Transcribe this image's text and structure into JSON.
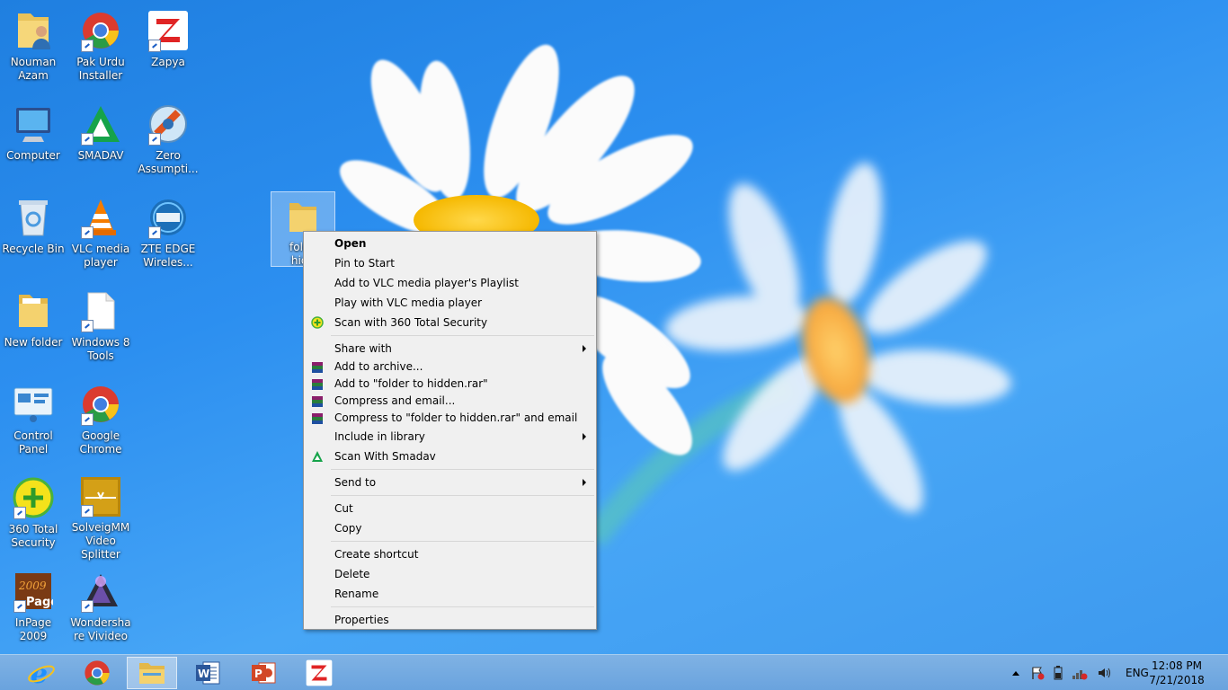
{
  "desktop": {
    "icons": [
      {
        "label": "Nouman Azam",
        "icon": "user-folder-icon"
      },
      {
        "label": "Pak Urdu Installer",
        "icon": "chrome-icon"
      },
      {
        "label": "Zapya",
        "icon": "zapya-icon"
      },
      {
        "label": "Computer",
        "icon": "computer-icon"
      },
      {
        "label": "SMADAV",
        "icon": "smadav-icon"
      },
      {
        "label": "Zero Assumpti...",
        "icon": "zero-assumption-icon"
      },
      {
        "label": "Recycle Bin",
        "icon": "recycle-bin-icon"
      },
      {
        "label": "VLC media player",
        "icon": "vlc-icon"
      },
      {
        "label": "ZTE EDGE Wireles...",
        "icon": "zte-icon"
      },
      {
        "label": "New folder",
        "icon": "folder-icon"
      },
      {
        "label": "Windows 8 Tools",
        "icon": "file-icon"
      },
      {
        "label": "Control Panel",
        "icon": "control-panel-icon"
      },
      {
        "label": "Google Chrome",
        "icon": "chrome-icon"
      },
      {
        "label": "360 Total Security",
        "icon": "360-security-icon"
      },
      {
        "label": "SolveigMM Video Splitter",
        "icon": "video-splitter-icon"
      },
      {
        "label": "InPage 2009",
        "icon": "inpage-icon"
      },
      {
        "label": "Wondershare Vivideo",
        "icon": "wondershare-icon"
      }
    ],
    "selected_folder": {
      "label_line1": "folde",
      "label_line2": "hidd",
      "icon": "folder-icon"
    }
  },
  "context_menu": {
    "items": [
      {
        "label": "Open"
      },
      {
        "label": "Pin to Start"
      },
      {
        "label": "Add to VLC media player's Playlist"
      },
      {
        "label": "Play with VLC media player"
      },
      {
        "label": "Scan with 360 Total Security",
        "icon": "360-security-icon"
      },
      {
        "label": "Share with"
      },
      {
        "label": "Add to archive...",
        "icon": "winrar-icon"
      },
      {
        "label": "Add to \"folder to hidden.rar\"",
        "icon": "winrar-icon"
      },
      {
        "label": "Compress and email...",
        "icon": "winrar-icon"
      },
      {
        "label": "Compress to \"folder to hidden.rar\" and email",
        "icon": "winrar-icon"
      },
      {
        "label": "Include in library"
      },
      {
        "label": "Scan With Smadav",
        "icon": "smadav-icon"
      },
      {
        "label": "Send to"
      },
      {
        "label": "Cut"
      },
      {
        "label": "Copy"
      },
      {
        "label": "Create shortcut"
      },
      {
        "label": "Delete"
      },
      {
        "label": "Rename"
      },
      {
        "label": "Properties"
      }
    ]
  },
  "taskbar": {
    "apps": [
      "internet-explorer-icon",
      "chrome-icon",
      "file-explorer-icon",
      "word-icon",
      "powerpoint-icon",
      "zapya-icon"
    ],
    "tray": {
      "language": "ENG",
      "time": "12:08 PM",
      "date": "7/21/2018"
    }
  },
  "colors": {
    "desktop_blue": "#2c8ff0",
    "taskbar": "#6aa3de",
    "menu_bg": "#f0f0f0"
  }
}
